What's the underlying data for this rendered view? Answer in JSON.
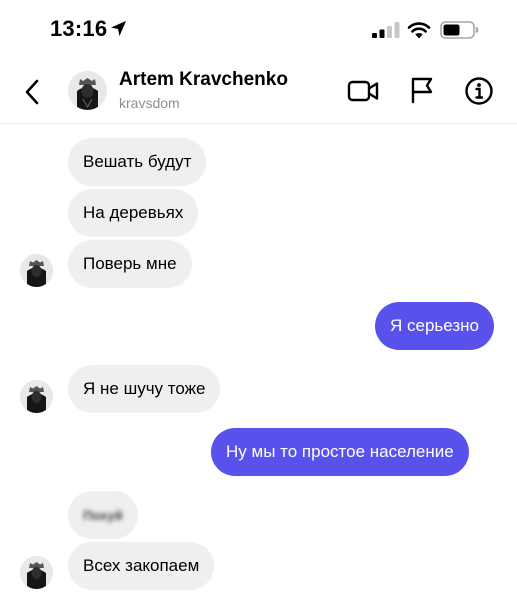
{
  "status_bar": {
    "time": "13:16",
    "icons": [
      "location-arrow-icon",
      "cellular-signal-icon",
      "wifi-icon",
      "battery-icon"
    ]
  },
  "header": {
    "name": "Artem Kravchenko",
    "username": "kravsdom",
    "icons": [
      "back-chevron-icon",
      "video-call-icon",
      "flag-icon",
      "info-icon"
    ]
  },
  "colors": {
    "incoming_bubble": "#efefef",
    "outgoing_bubble": "#5851ec",
    "username_gray": "#8e8e8e"
  },
  "messages": [
    {
      "side": "incoming",
      "text": "Вешать будут"
    },
    {
      "side": "incoming",
      "text": "На деревьях"
    },
    {
      "side": "incoming",
      "text": "Поверь мне"
    },
    {
      "side": "outgoing",
      "text": "Я серьезно"
    },
    {
      "side": "incoming",
      "text": "Я не шучу тоже"
    },
    {
      "side": "outgoing",
      "text": "Ну мы то простое население"
    },
    {
      "side": "incoming",
      "text": "Похуй",
      "blurred": true
    },
    {
      "side": "incoming",
      "text": "Всех закопаем"
    }
  ]
}
